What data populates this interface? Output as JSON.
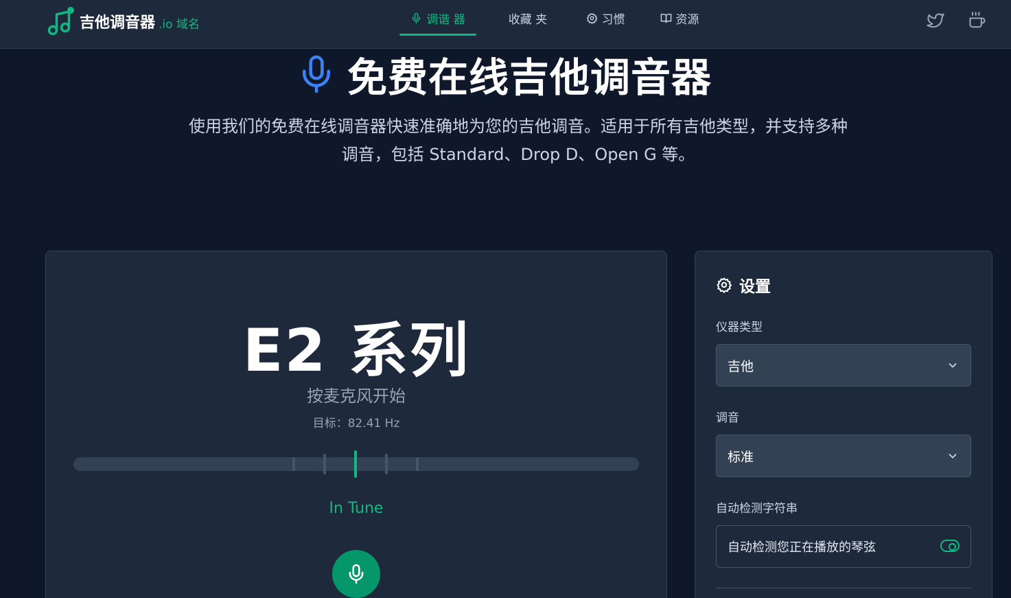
{
  "colors": {
    "accent": "#10b981",
    "background": "#0f172a",
    "card": "#1e293b",
    "mic_button": "#059669"
  },
  "header": {
    "logo_icon": "music-note-icon",
    "logo_title": "吉他调音器",
    "logo_suffix": ".io 域名",
    "nav": [
      {
        "label": "调谐 器",
        "icon": "microphone-icon",
        "active": true
      },
      {
        "label": "收藏 夹",
        "icon": "",
        "active": false
      },
      {
        "label": "习惯",
        "icon": "gear-icon",
        "active": false
      },
      {
        "label": "资源",
        "icon": "book-icon",
        "active": false
      }
    ],
    "icons": [
      "twitter-icon",
      "coffee-icon"
    ]
  },
  "hero": {
    "title": "免费在线吉他调音器",
    "description": "使用我们的免费在线调音器快速准确地为您的吉他调音。适用于所有吉他类型，并支持多种调音，包括 Standard、Drop D、Open G 等。"
  },
  "tuner": {
    "note": "E2 系列",
    "hint": "按麦克风开始",
    "target": "目标：82.41 Hz",
    "status": "In Tune"
  },
  "settings": {
    "title": "设置",
    "instrument_label": "仪器类型",
    "instrument_value": "吉他",
    "tuning_label": "调音",
    "tuning_value": "标准",
    "auto_detect_label": "自动检测字符串",
    "auto_detect_text": "自动检测您正在播放的琴弦",
    "auto_detect_on": true
  }
}
